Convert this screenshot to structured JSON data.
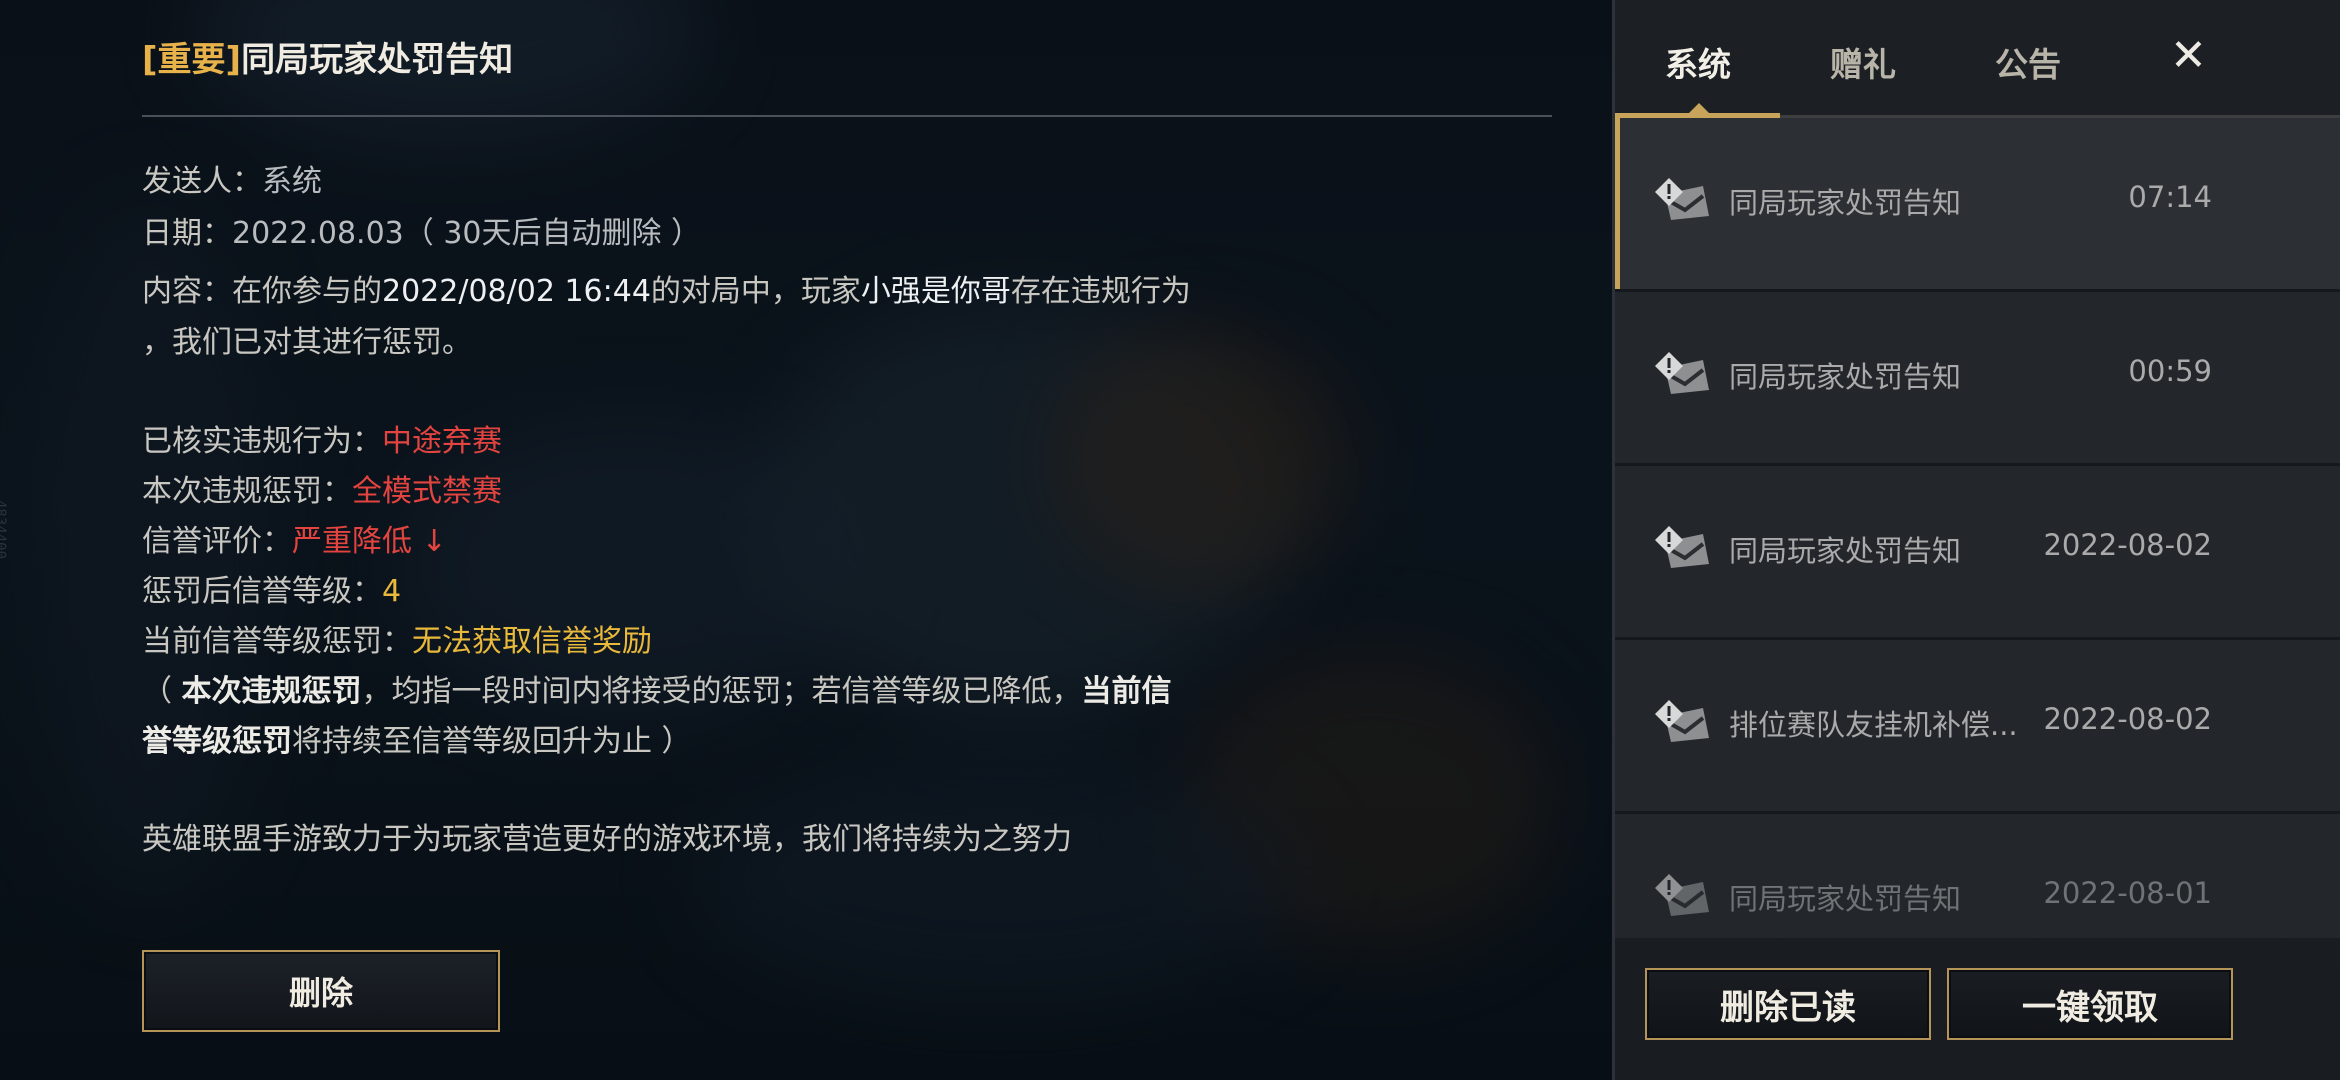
{
  "detail": {
    "title_tag": "[重要]",
    "title": "同局玩家处罚告知",
    "sender_label": "发送人：",
    "sender": "系统",
    "date_label": "日期：",
    "date": "2022.08.03",
    "date_note": "（ 30天后自动删除 ）",
    "content_label": "内容：",
    "content_a": "在你参与的",
    "content_time": "2022/08/02 16:44",
    "content_b": "的对局中，玩家",
    "content_player": "小强是你哥",
    "content_c": "存在违规行为",
    "content_line2": "，我们已对其进行惩罚。",
    "violation_label": "已核实违规行为：",
    "violation": "中途弃赛",
    "penalty_label": "本次违规惩罚：",
    "penalty": "全模式禁赛",
    "credit_label": "信誉评价：",
    "credit": "严重降低 ↓",
    "level_label": "惩罚后信誉等级：",
    "level": "4",
    "current_label": "当前信誉等级惩罚：",
    "current": "无法获取信誉奖励",
    "note_open": "（ ",
    "note_b1": "本次违规惩罚",
    "note_mid": "，均指一段时间内将接受的惩罚；若信誉等级已降低，",
    "note_b2": "当前信",
    "note_b3": "誉等级惩罚",
    "note_end": "将持续至信誉等级回升为止 ）",
    "footer": "英雄联盟手游致力于为玩家营造更好的游戏环境，我们将持续为之努力",
    "delete_button": "删除"
  },
  "side_id": "4834400",
  "panel": {
    "tabs": [
      "系统",
      "赠礼",
      "公告"
    ],
    "active_tab": "系统",
    "close_icon": "close-icon",
    "mails": [
      {
        "title": "同局玩家处罚告知",
        "date": "07:14",
        "selected": true
      },
      {
        "title": "同局玩家处罚告知",
        "date": "00:59",
        "selected": false
      },
      {
        "title": "同局玩家处罚告知",
        "date": "2022-08-02",
        "selected": false
      },
      {
        "title": "排位赛队友挂机补偿...",
        "date": "2022-08-02",
        "selected": false
      },
      {
        "title": "同局玩家处罚告知",
        "date": "2022-08-01",
        "selected": false
      }
    ],
    "delete_read_button": "删除已读",
    "claim_all_button": "一键领取"
  },
  "colors": {
    "accent_gold": "#c8a45b",
    "warning_red": "#e3443f",
    "highlight_yellow": "#e8b93a"
  }
}
